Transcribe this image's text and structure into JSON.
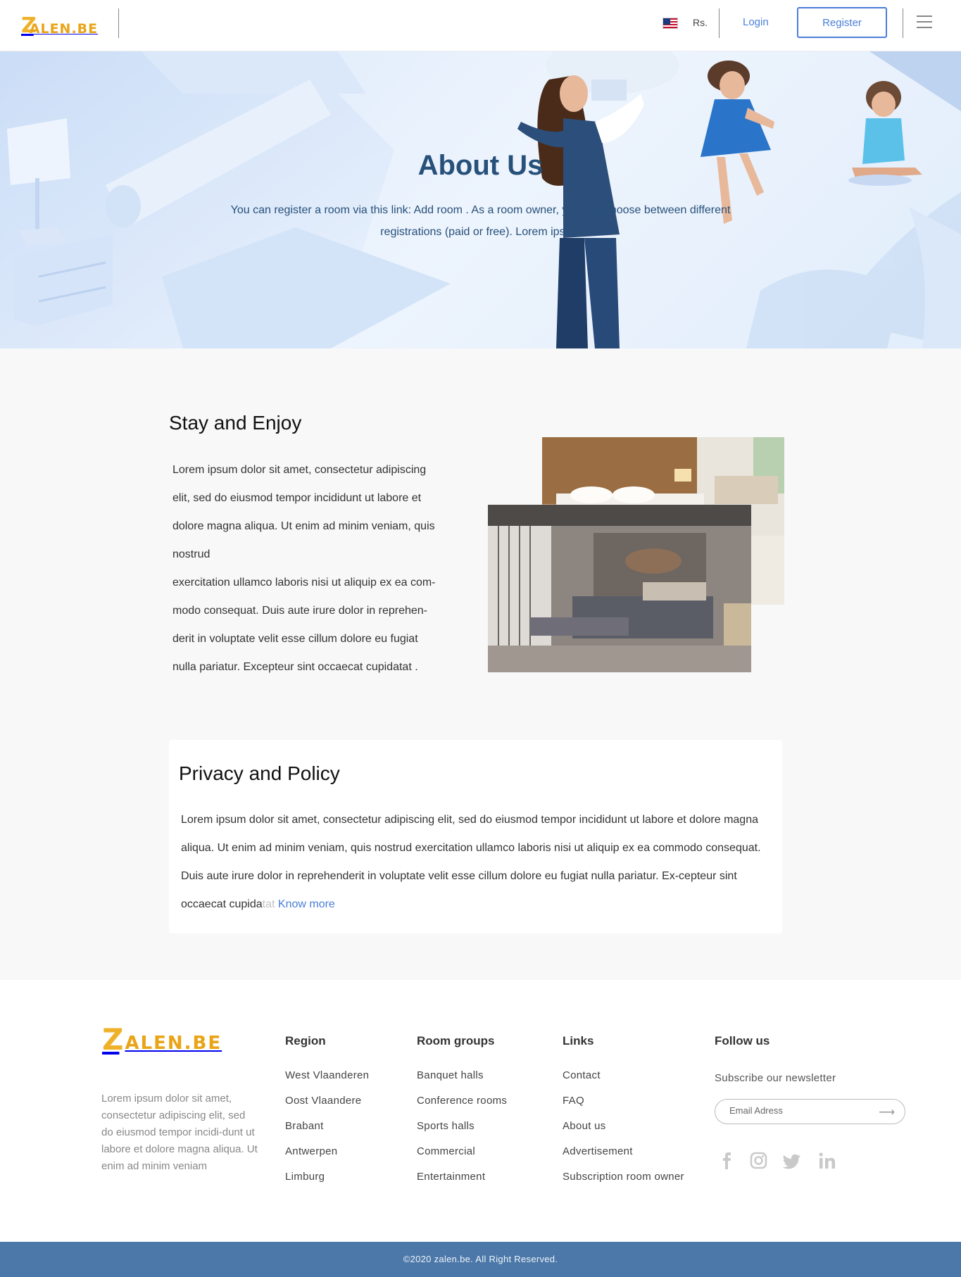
{
  "header": {
    "logo_mark": "Z",
    "logo_text": "ALEN.BE",
    "currency": "Rs.",
    "login_label": "Login",
    "register_label": "Register"
  },
  "hero": {
    "title": "About Us",
    "text": "You can register a room via this link: Add room . As a room owner, you can choose between different registrations (paid or free). Lorem ipsum"
  },
  "stay": {
    "title": "Stay and Enjoy",
    "lines": [
      "Lorem ipsum dolor sit amet, consectetur adipiscing",
      "elit, sed do eiusmod tempor incididunt ut labore et",
      "dolore magna aliqua. Ut enim ad minim veniam, quis",
      "nostrud",
      "exercitation ullamco laboris nisi ut aliquip ex ea com-",
      "modo consequat. Duis aute irure dolor in reprehen-",
      "derit in voluptate velit esse cillum dolore eu fugiat",
      "nulla pariatur. Excepteur sint occaecat cupidatat ."
    ]
  },
  "privacy": {
    "title": "Privacy and Policy",
    "text": "Lorem ipsum dolor sit amet, consectetur adipiscing elit, sed do eiusmod tempor incididunt ut labore et dolore magna aliqua. Ut enim ad minim veniam, quis nostrud exercitation ullamco laboris nisi ut aliquip ex ea commodo consequat. Duis aute irure dolor in reprehenderit in voluptate velit esse cillum dolore eu fugiat nulla pariatur. Ex-cepteur sint occaecat cupida",
    "faded": "tat",
    "know_more": "Know more"
  },
  "footer": {
    "logo_mark": "Z",
    "logo_text": "ALEN.BE",
    "description": "Lorem ipsum dolor sit amet, consectetur adipiscing elit, sed do eiusmod tempor incidi-dunt ut labore et dolore magna aliqua. Ut enim ad minim veniam",
    "region": {
      "title": "Region",
      "items": [
        "West Vlaanderen",
        "Oost Vlaandere",
        "Brabant",
        "Antwerpen",
        "Limburg"
      ]
    },
    "room_groups": {
      "title": "Room groups",
      "items": [
        "Banquet halls",
        "Conference rooms",
        "Sports halls",
        "Commercial",
        "Entertainment"
      ]
    },
    "links": {
      "title": "Links",
      "items": [
        "Contact",
        "FAQ",
        "About us",
        "Advertisement",
        "Subscription room owner"
      ]
    },
    "follow": {
      "title": "Follow us",
      "newsletter": "Subscribe our newsletter",
      "email_placeholder": "Email Adress",
      "social": [
        "facebook-icon",
        "instagram-icon",
        "twitter-icon",
        "linkedin-icon"
      ]
    },
    "copyright": "©2020 zalen.be. All Right Reserved."
  },
  "colors": {
    "accent": "#4a7fd8",
    "brand": "#f0b12a",
    "hero_title": "#27507a",
    "footer_bar": "#4b78a8"
  }
}
